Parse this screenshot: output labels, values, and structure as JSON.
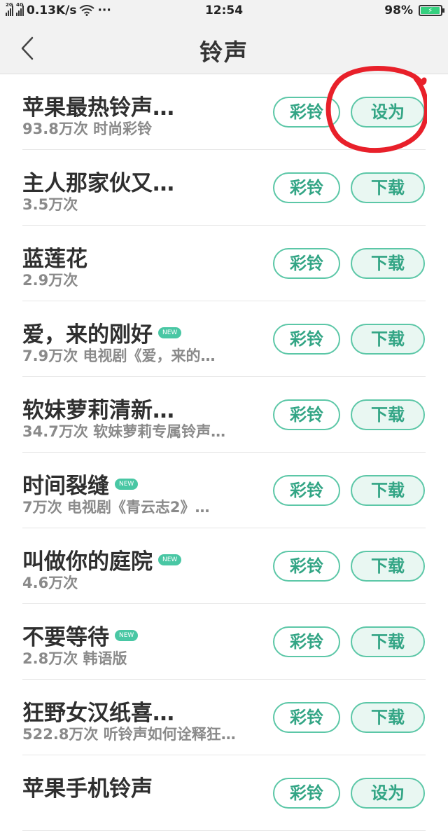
{
  "status_bar": {
    "net1": "2G",
    "net2": "4G",
    "speed": "0.13K/s",
    "dots": "···",
    "time": "12:54",
    "battery": "98%",
    "battery_level": 0.98
  },
  "header": {
    "title": "铃声"
  },
  "ringtones": [
    {
      "name": "苹果最热铃声…",
      "sub": "93.8万次  时尚彩铃",
      "new": false,
      "btn1": "彩铃",
      "btn2": "设为"
    },
    {
      "name": "主人那家伙又…",
      "sub": "3.5万次",
      "new": false,
      "btn1": "彩铃",
      "btn2": "下载"
    },
    {
      "name": "蓝莲花",
      "sub": "2.9万次",
      "new": false,
      "btn1": "彩铃",
      "btn2": "下载"
    },
    {
      "name": "爱，来的刚好",
      "sub": "7.9万次  电视剧《爱，来的…",
      "new": true,
      "btn1": "彩铃",
      "btn2": "下载"
    },
    {
      "name": "软妹萝莉清新…",
      "sub": "34.7万次  软妹萝莉专属铃声…",
      "new": false,
      "btn1": "彩铃",
      "btn2": "下载"
    },
    {
      "name": "时间裂缝",
      "sub": "7万次  电视剧《青云志2》…",
      "new": true,
      "btn1": "彩铃",
      "btn2": "下载"
    },
    {
      "name": "叫做你的庭院",
      "sub": "4.6万次",
      "new": true,
      "btn1": "彩铃",
      "btn2": "下载"
    },
    {
      "name": "不要等待",
      "sub": "2.8万次  韩语版",
      "new": true,
      "btn1": "彩铃",
      "btn2": "下载"
    },
    {
      "name": "狂野女汉纸喜…",
      "sub": "522.8万次  听铃声如何诠释狂…",
      "new": false,
      "btn1": "彩铃",
      "btn2": "下载"
    },
    {
      "name": "苹果手机铃声",
      "sub": "",
      "new": false,
      "btn1": "彩铃",
      "btn2": "设为"
    }
  ],
  "new_badge": "NEW",
  "colors": {
    "accent": "#5cc7a7",
    "annotation": "#e8202a"
  }
}
